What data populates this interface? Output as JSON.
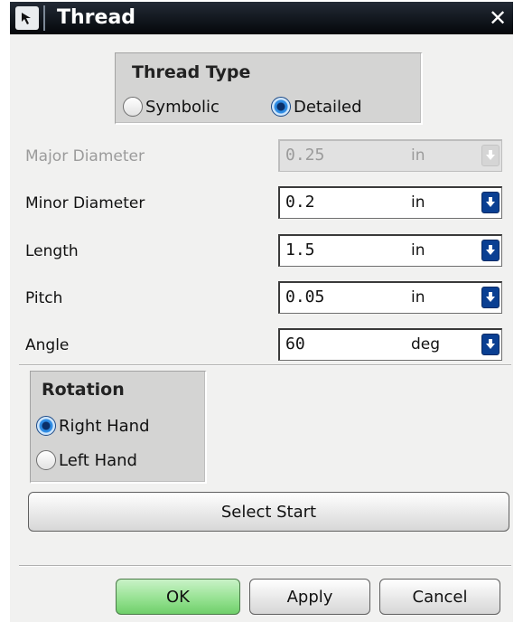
{
  "window": {
    "title": "Thread",
    "close_glyph": "✕"
  },
  "thread_type": {
    "title": "Thread Type",
    "options": [
      {
        "label": "Symbolic",
        "selected": false
      },
      {
        "label": "Detailed",
        "selected": true
      }
    ]
  },
  "params": [
    {
      "label": "Major Diameter",
      "value": "0.25",
      "unit": "in",
      "enabled": false
    },
    {
      "label": "Minor Diameter",
      "value": "0.2",
      "unit": "in",
      "enabled": true
    },
    {
      "label": "Length",
      "value": "1.5",
      "unit": "in",
      "enabled": true
    },
    {
      "label": "Pitch",
      "value": "0.05",
      "unit": "in",
      "enabled": true
    },
    {
      "label": "Angle",
      "value": "60",
      "unit": "deg",
      "enabled": true
    }
  ],
  "rotation": {
    "title": "Rotation",
    "options": [
      {
        "label": "Right Hand",
        "selected": true
      },
      {
        "label": "Left Hand",
        "selected": false
      }
    ]
  },
  "select_start_label": "Select Start",
  "buttons": {
    "ok": "OK",
    "apply": "Apply",
    "cancel": "Cancel"
  },
  "colors": {
    "accent": "#0a3f92",
    "ok_green": "#97e293",
    "titlebar": "#0d1117"
  },
  "icons": {
    "title": "arrow-select-icon",
    "dropdown": "dropdown-arrow-icon"
  }
}
